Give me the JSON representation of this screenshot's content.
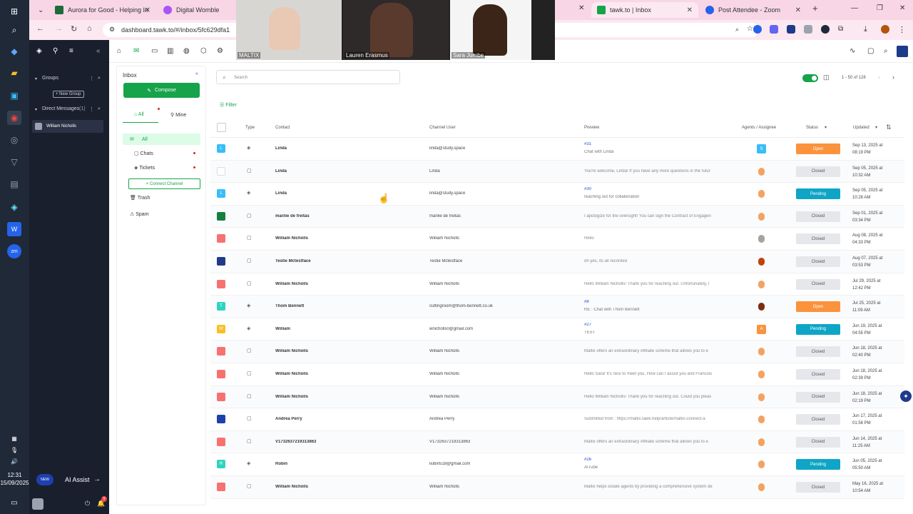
{
  "taskbar": {
    "time": "12:31",
    "date": "15/09/2025"
  },
  "browser": {
    "tabs": [
      {
        "label": "Aurora for Good - Helping In",
        "color": "#1e6b3a"
      },
      {
        "label": "Digital Womble",
        "color": "#a855f7"
      },
      {
        "label": "tawk.to | Inbox",
        "color": "#16a34a"
      },
      {
        "label": "Post Attendee - Zoom",
        "color": "#2563eb"
      }
    ],
    "url": "dashboard.tawk.to/#/inbox/5fc629dfa1"
  },
  "video": {
    "participants": [
      "MALTIX",
      "Lauren Erasmus",
      "Sara Jumbe"
    ]
  },
  "tawk_sidebar": {
    "groups_label": "Groups",
    "new_group": "+ New Group",
    "dm_label": "Direct Messages",
    "dm_count": "(1)",
    "dm_user": "William Nicholls",
    "ai_badge": "NEW",
    "ai_assist": "AI Assist",
    "notif_count": "9"
  },
  "inbox": {
    "title": "Inbox",
    "compose": "Compose",
    "tab_all": "All",
    "tab_mine": "Mine",
    "folders": [
      "All",
      "Chats",
      "Tickets"
    ],
    "connect_channel": "+ Connect Channel",
    "trash": "Trash",
    "spam": "Spam"
  },
  "main": {
    "search_placeholder": "Search",
    "filter": "Filter",
    "pagination": "1 - 50 of 128",
    "headers": {
      "type": "Type",
      "contact": "Contact",
      "channel_user": "Channel User",
      "preview": "Preview",
      "agents": "Agents / Assignee",
      "status": "Status",
      "updated": "Updated"
    },
    "rows": [
      {
        "avatar": "L",
        "avatar_color": "#38bdf8",
        "type": "ticket",
        "contact": "Linda",
        "channel_user": "linda@study.space",
        "preview_link": "#31",
        "preview": "Chat with Linda",
        "agent": "S",
        "agent_color": "#38bdf8",
        "status": "Open",
        "updated1": "Sep 13, 2025 at",
        "updated2": "08:19 PM"
      },
      {
        "avatar": "",
        "avatar_color": "#fff",
        "type": "chat",
        "contact": "Linda",
        "channel_user": "Linda",
        "preview_link": "",
        "preview": "You're welcome, Linda! If you have any more questions in the futur",
        "agent": "",
        "agent_color": "#f4a261",
        "status": "Closed",
        "updated1": "Sep 05, 2025 at",
        "updated2": "10:32 AM"
      },
      {
        "avatar": "L",
        "avatar_color": "#38bdf8",
        "type": "ticket",
        "contact": "Linda",
        "channel_user": "linda@study.space",
        "preview_link": "#30",
        "preview": "reaching out for collaboration",
        "agent": "",
        "agent_color": "#f4a261",
        "status": "Pending",
        "updated1": "Sep 05, 2025 at",
        "updated2": "10:28 AM"
      },
      {
        "avatar": "",
        "avatar_color": "#15803d",
        "type": "chat",
        "contact": "marilie de freitas",
        "channel_user": "marilie de freitas",
        "preview_link": "",
        "preview": "I apologize for the oversight! You can sign the Contract of Engagen",
        "agent": "",
        "agent_color": "#f4a261",
        "status": "Closed",
        "updated1": "Sep 01, 2025 at",
        "updated2": "03:34 PM"
      },
      {
        "avatar": "",
        "avatar_color": "#f87171",
        "type": "chat",
        "contact": "William Nicholls",
        "channel_user": "William Nicholls",
        "preview_link": "",
        "preview": "Hello",
        "agent": "",
        "agent_color": "#a8a29e",
        "status": "Closed",
        "updated1": "Aug 08, 2025 at",
        "updated2": "04:33 PM"
      },
      {
        "avatar": "",
        "avatar_color": "#1e3a8a",
        "type": "chat",
        "contact": "Testie Mctestface",
        "channel_user": "Testie Mctestface",
        "preview_link": "",
        "preview": "oh yes, its all recorded",
        "agent": "",
        "agent_color": "#c2410c",
        "status": "Closed",
        "updated1": "Aug 07, 2025 at",
        "updated2": "03:53 PM"
      },
      {
        "avatar": "",
        "avatar_color": "#f87171",
        "type": "chat",
        "contact": "William Nicholls",
        "channel_user": "William Nicholls",
        "preview_link": "",
        "preview": "Hello William Nicholls! Thank you for reaching out. Unfortunately, I",
        "agent": "",
        "agent_color": "#f4a261",
        "status": "Closed",
        "updated1": "Jul 29, 2025 at",
        "updated2": "12:42 PM"
      },
      {
        "avatar": "T",
        "avatar_color": "#2dd4bf",
        "type": "ticket",
        "contact": "Thom Bennett",
        "channel_user": "cuttingroom@thom-bennett.co.uk",
        "preview_link": "#8",
        "preview": "RE : Chat with Thom Bennett",
        "agent": "",
        "agent_color": "#7c2d12",
        "status": "Open",
        "updated1": "Jul 25, 2025 at",
        "updated2": "11:09 AM"
      },
      {
        "avatar": "W",
        "avatar_color": "#fbbf24",
        "type": "ticket",
        "contact": "William",
        "channel_user": "wnicholls0@gmail.com",
        "preview_link": "#27",
        "preview": "TEST",
        "agent": "A",
        "agent_color": "#fb923c",
        "status": "Pending",
        "updated1": "Jun 19, 2025 at",
        "updated2": "04:55 PM"
      },
      {
        "avatar": "",
        "avatar_color": "#f87171",
        "type": "chat",
        "contact": "William Nicholls",
        "channel_user": "William Nicholls",
        "preview_link": "",
        "preview": "Maltix offers an extraordinary Affiliate scheme that allows you to e",
        "agent": "",
        "agent_color": "#f4a261",
        "status": "Closed",
        "updated1": "Jun 18, 2025 at",
        "updated2": "02:40 PM"
      },
      {
        "avatar": "",
        "avatar_color": "#f87171",
        "type": "chat",
        "contact": "William Nicholls",
        "channel_user": "William Nicholls",
        "preview_link": "",
        "preview": "Hello Sara! It's nice to meet you. How can I assist you and Francois",
        "agent": "",
        "agent_color": "#f4a261",
        "status": "Closed",
        "updated1": "Jun 18, 2025 at",
        "updated2": "02:39 PM"
      },
      {
        "avatar": "",
        "avatar_color": "#f87171",
        "type": "chat",
        "contact": "William Nicholls",
        "channel_user": "William Nicholls",
        "preview_link": "",
        "preview": "Hello William Nicholls! Thank you for reaching out. Could you pleas",
        "agent": "",
        "agent_color": "#f4a261",
        "status": "Closed",
        "updated1": "Jun 18, 2025 at",
        "updated2": "02:19 PM"
      },
      {
        "avatar": "",
        "avatar_color": "#1e40af",
        "type": "chat",
        "contact": "Andrea Perry",
        "channel_user": "Andrea Perry",
        "preview_link": "",
        "preview": "Submitted from : https://maltix.tawk.help/article/maltix-connect-a",
        "agent": "",
        "agent_color": "#f4a261",
        "status": "Closed",
        "updated1": "Jun 17, 2025 at",
        "updated2": "01:58 PM"
      },
      {
        "avatar": "",
        "avatar_color": "#f87171",
        "type": "chat",
        "contact": "V1732637219313863",
        "channel_user": "V1732637219313863",
        "preview_link": "",
        "preview": "Maltix offers an extraordinary Affiliate scheme that allows you to e",
        "agent": "",
        "agent_color": "#f4a261",
        "status": "Closed",
        "updated1": "Jun 14, 2025 at",
        "updated2": "11:25 AM"
      },
      {
        "avatar": "R",
        "avatar_color": "#2dd4bf",
        "type": "ticket",
        "contact": "Robin",
        "channel_user": "liubin518@gmail.com",
        "preview_link": "#26",
        "preview": "AITube",
        "agent": "",
        "agent_color": "#f4a261",
        "status": "Pending",
        "updated1": "Jun 05, 2025 at",
        "updated2": "05:50 AM"
      },
      {
        "avatar": "",
        "avatar_color": "#f87171",
        "type": "chat",
        "contact": "William Nicholls",
        "channel_user": "William Nicholls",
        "preview_link": "",
        "preview": "Maltix helps estate agents by providing a comprehensive system de",
        "agent": "",
        "agent_color": "#f4a261",
        "status": "Closed",
        "updated1": "May 16, 2025 at",
        "updated2": "10:54 AM"
      }
    ]
  }
}
